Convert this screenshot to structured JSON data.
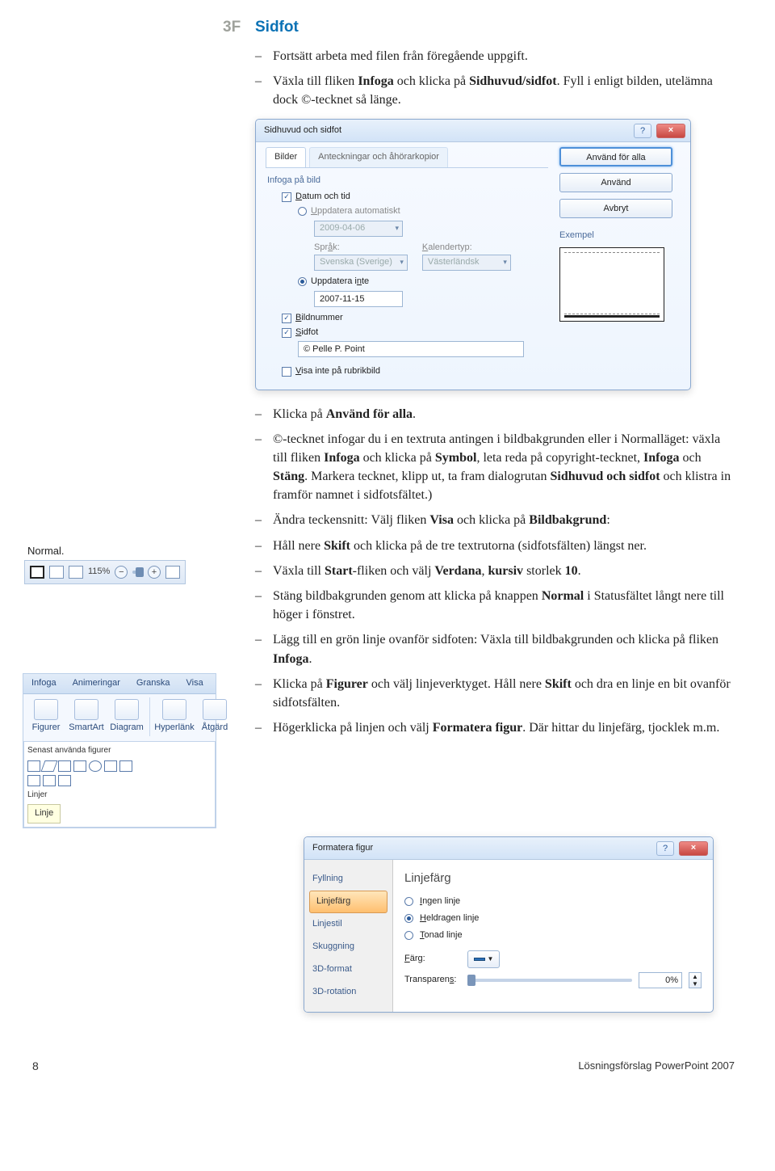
{
  "heading": {
    "num": "3F",
    "title": "Sidfot"
  },
  "intro": {
    "line1": "Fortsätt arbeta med filen från föregående uppgift.",
    "line2a": "Växla till fliken ",
    "line2b": "Infoga",
    "line2c": " och klicka på ",
    "line2d": "Sidhuvud/sidfot",
    "line2e": ". Fyll i enligt bilden, utelämna dock ©-tecknet så länge."
  },
  "dialog1": {
    "title": "Sidhuvud och sidfot",
    "tab_active": "Bilder",
    "tab_inactive": "Anteckningar och åhörarkopior",
    "group_infoga": "Infoga på bild",
    "cb_datum": "Datum och tid",
    "rb_auto": "Uppdatera automatiskt",
    "date_auto": "2009-04-06",
    "lbl_sprak": "Språk:",
    "val_sprak": "Svenska (Sverige)",
    "lbl_kalender": "Kalendertyp:",
    "val_kalender": "Västerländsk",
    "rb_inte": "Uppdatera inte",
    "date_fixed": "2007-11-15",
    "cb_bildnr": "Bildnummer",
    "cb_sidfot": "Sidfot",
    "sidfot_text": "© Pelle P. Point",
    "cb_rubrik": "Visa inte på rubrikbild",
    "btn_all": "Använd för alla",
    "btn_apply": "Använd",
    "btn_cancel": "Avbryt",
    "exempel": "Exempel"
  },
  "normal_label": "Normal.",
  "statusbar": {
    "zoom": "115%"
  },
  "ribbon": {
    "tab1": "Infoga",
    "tab2": "Animeringar",
    "tab3": "Granska",
    "tab4": "Visa",
    "btn_figurer": "Figurer",
    "btn_smartart": "SmartArt",
    "btn_diagram": "Diagram",
    "btn_hyperlank": "Hyperlänk",
    "btn_atgard": "Åtgärd",
    "gallery_title": "Senast använda figurer",
    "tooltip": "Linje",
    "row_linje": "Linje"
  },
  "body": {
    "i1": "Klicka på ",
    "i1b": "Använd för alla",
    "i1c": ".",
    "i2": "©-tecknet infogar du i en textruta antingen i bildbakgrunden eller i Normalläget: växla till fliken ",
    "i2b": "Infoga",
    "i2c": " och klicka på ",
    "i2d": "Symbol",
    "i2e": ", leta reda på copyright-tecknet, ",
    "i2f": "Infoga",
    "i2g": " och ",
    "i2h": "Stäng",
    "i2i": ". Markera tecknet, klipp ut, ta fram dialogrutan ",
    "i2j": "Sidhuvud och sidfot",
    "i2k": " och klistra in framför namnet i sidfotsfältet.)",
    "i3": "Ändra teckensnitt: Välj fliken ",
    "i3b": "Visa",
    "i3c": " och klicka på ",
    "i3d": "Bildbakgrund",
    "i3e": ":",
    "i4": "Håll nere ",
    "i4b": "Skift",
    "i4c": " och klicka på de tre textrutorna (sidfotsfälten) längst ner.",
    "i5": "Växla till ",
    "i5b": "Start",
    "i5c": "-fliken och välj ",
    "i5d": "Verdana",
    "i5e": ", ",
    "i5f": "kursiv",
    "i5g": " storlek ",
    "i5h": "10",
    "i5i": ".",
    "i6": "Stäng bildbakgrunden genom att klicka på knappen ",
    "i6b": "Normal",
    "i6c": " i Statusfältet långt nere till höger i fönstret.",
    "i7": "Lägg till en grön linje ovanför sidfoten: Växla till bildbakgrunden och klicka på fliken ",
    "i7b": "Infoga",
    "i7c": ".",
    "i8": "Klicka på ",
    "i8b": "Figurer",
    "i8c": " och välj linjeverktyget. Håll nere ",
    "i8d": "Skift",
    "i8e": " och dra en linje en bit ovanför sidfotsfälten.",
    "i9": "Högerklicka på linjen och välj ",
    "i9b": "Formatera figur",
    "i9c": ". Där hittar du linjefärg, tjocklek m.m."
  },
  "format": {
    "title": "Formatera figur",
    "side": {
      "fyll": "Fyllning",
      "farg": "Linjefärg",
      "stil": "Linjestil",
      "skugg": "Skuggning",
      "fmt": "3D-format",
      "rot": "3D-rotation"
    },
    "heading": "Linjefärg",
    "rb_none": "Ingen linje",
    "rb_solid": "Heldragen linje",
    "rb_grad": "Tonad linje",
    "lbl_farg": "Färg:",
    "lbl_trans": "Transparens:",
    "pct": "0%"
  },
  "footer": {
    "page": "8",
    "credit": "Lösningsförslag PowerPoint 2007"
  }
}
